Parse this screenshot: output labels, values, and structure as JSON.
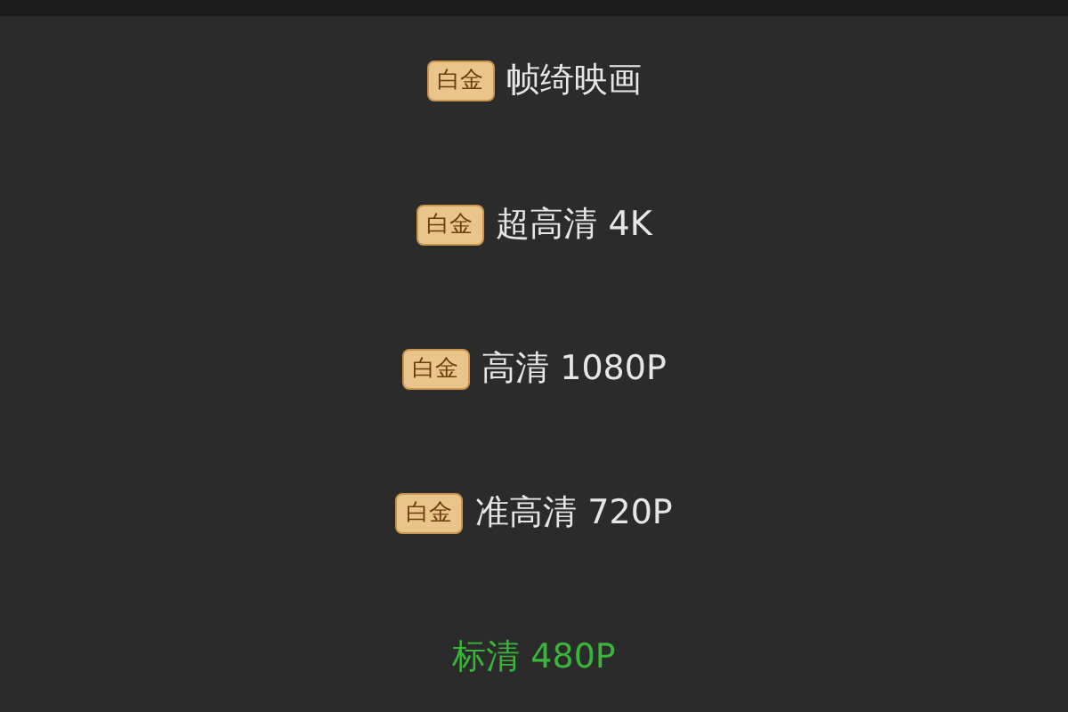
{
  "options": [
    {
      "badge": "白金",
      "label": "帧绮映画",
      "selected": false
    },
    {
      "badge": "白金",
      "label": "超高清 4K",
      "selected": false
    },
    {
      "badge": "白金",
      "label": "高清 1080P",
      "selected": false
    },
    {
      "badge": "白金",
      "label": "准高清 720P",
      "selected": false
    },
    {
      "label": "标清 480P",
      "selected": true
    }
  ]
}
